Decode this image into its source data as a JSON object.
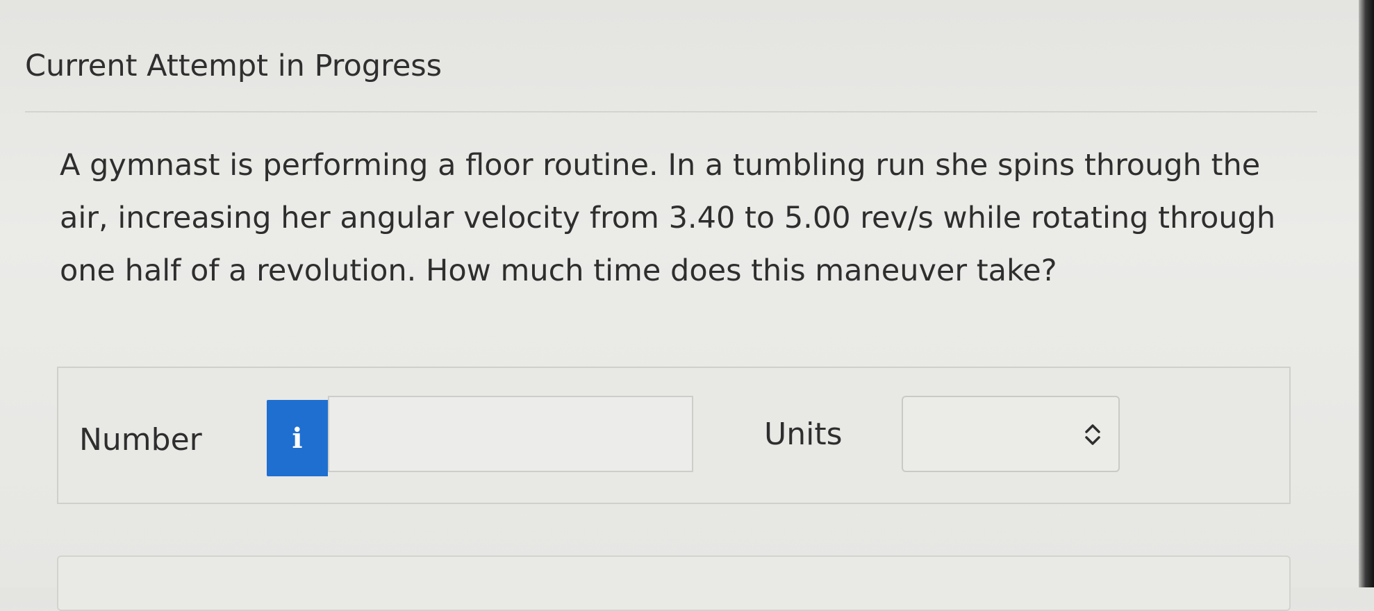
{
  "header": {
    "title": "Current Attempt in Progress"
  },
  "question": {
    "text": "A gymnast is performing a floor routine. In a tumbling run she spins through the air, increasing her angular velocity from 3.40 to 5.00 rev/s while rotating through one half of a revolution. How much time does this maneuver take?"
  },
  "answer": {
    "number_label": "Number",
    "info_icon_glyph": "i",
    "number_value": "",
    "units_label": "Units",
    "units_selected": "",
    "icons": {
      "info": "info-icon",
      "select_chevron": "chevron-up-down-icon"
    }
  },
  "colors": {
    "info_button": "#1e6fd0",
    "background": "#e8e8e5"
  }
}
